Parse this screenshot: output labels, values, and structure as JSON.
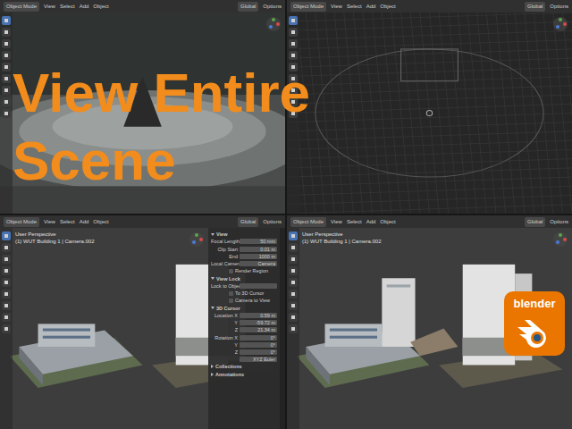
{
  "title": {
    "lines": [
      "View Entire",
      "Scene"
    ]
  },
  "logo": {
    "text": "blender"
  },
  "viewports": [
    {
      "kind": "textured",
      "header": {
        "mode": "Object Mode",
        "menus": [
          "View",
          "Select",
          "Add",
          "Object"
        ],
        "orientation": "Global",
        "options": "Options"
      },
      "info": []
    },
    {
      "kind": "wireframe",
      "header": {
        "mode": "Object Mode",
        "menus": [
          "View",
          "Select",
          "Add",
          "Object"
        ],
        "orientation": "Global",
        "options": "Options"
      },
      "info": []
    },
    {
      "kind": "buildings-two",
      "header": {
        "mode": "Object Mode",
        "menus": [
          "View",
          "Select",
          "Add",
          "Object"
        ],
        "orientation": "Global",
        "options": "Options"
      },
      "info": [
        "User Perspective",
        "(1) WUT Building 1 | Camera.002"
      ],
      "sidebar": [
        {
          "kind": "section",
          "label": "View",
          "expanded": true
        },
        {
          "kind": "field",
          "label": "Focal Length",
          "value": "50 mm"
        },
        {
          "kind": "field",
          "label": "Clip Start",
          "value": "0.01 m"
        },
        {
          "kind": "field",
          "label": "End",
          "value": "1000 m"
        },
        {
          "kind": "field",
          "label": "Local Camera",
          "value": "Camera"
        },
        {
          "kind": "checkbox",
          "label": "Render Region",
          "checked": false
        },
        {
          "kind": "section",
          "label": "View Lock",
          "expanded": true
        },
        {
          "kind": "field",
          "label": "Lock to Object",
          "value": ""
        },
        {
          "kind": "checkbox",
          "label": "To 3D Cursor",
          "checked": false
        },
        {
          "kind": "checkbox",
          "label": "Camera to View",
          "checked": false
        },
        {
          "kind": "section",
          "label": "3D Cursor",
          "expanded": true
        },
        {
          "kind": "field",
          "label": "Location X",
          "value": "0.59 m"
        },
        {
          "kind": "field",
          "label": "Y",
          "value": "-59.72 m"
        },
        {
          "kind": "field",
          "label": "Z",
          "value": "21.34 m"
        },
        {
          "kind": "field",
          "label": "Rotation X",
          "value": "0°"
        },
        {
          "kind": "field",
          "label": "Y",
          "value": "0°"
        },
        {
          "kind": "field",
          "label": "Z",
          "value": "0°"
        },
        {
          "kind": "field",
          "label": "",
          "value": "XYZ Euler"
        },
        {
          "kind": "section",
          "label": "Collections",
          "expanded": false
        },
        {
          "kind": "section",
          "label": "Annotations",
          "expanded": false
        }
      ]
    },
    {
      "kind": "buildings-three",
      "header": {
        "mode": "Object Mode",
        "menus": [
          "View",
          "Select",
          "Add",
          "Object"
        ],
        "orientation": "Global",
        "options": "Options"
      },
      "info": [
        "User Perspective",
        "(1) WUT Building 1 | Camera.002"
      ]
    }
  ]
}
